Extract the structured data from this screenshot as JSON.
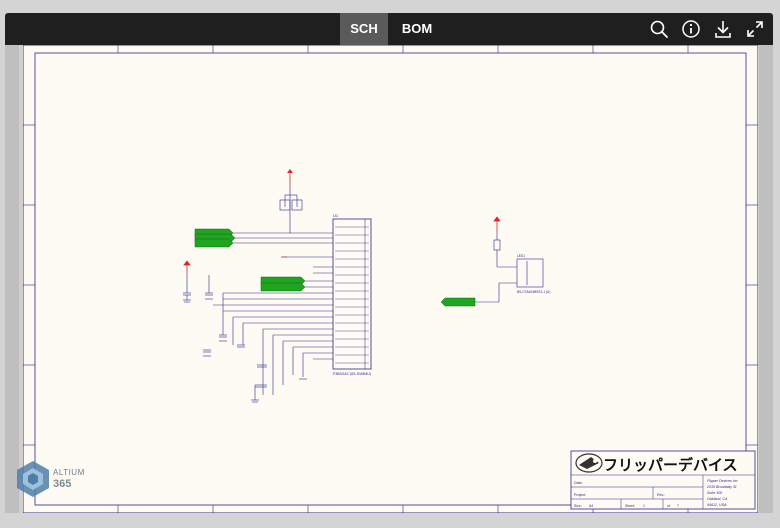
{
  "toolbar": {
    "tabs": [
      {
        "label": "SCH",
        "active": true
      },
      {
        "label": "BOM",
        "active": false
      }
    ],
    "icons": [
      "search-icon",
      "info-icon",
      "download-icon",
      "fullscreen-icon"
    ]
  },
  "schematic": {
    "ic_label": "U1",
    "ic_part": "P3B4GAC (6S-SVMMU)",
    "led_label": "LED1",
    "led_part": "BS-CTA4S4BSS1-1 (U)",
    "net_labels_green": [
      "SWD_MIO",
      "SWD_CLK",
      "SWD_RST",
      "UART_TX",
      "UART_RX",
      "LED_CTRL"
    ],
    "title_block": {
      "logo_text": "フリッパーデバイス",
      "company_lines": [
        "Flipper Devices Inc",
        "2035 Broadway St",
        "Suite 300",
        "Oakland, CA",
        "94612, USA"
      ],
      "date_label": "Date:",
      "project_label": "Project:",
      "rev_label": "Rev.:",
      "size_label": "Size:",
      "size_value": "A4",
      "sheet_label": "Sheet:",
      "sheet_value": "1",
      "of_label": "of",
      "of_value": "7"
    }
  },
  "branding": {
    "line1": "ALTIUM",
    "line2": "365"
  },
  "colors": {
    "toolbar_bg": "#1f1f1f",
    "active_tab": "#5a5a5a",
    "sheet_bg": "#fdfbf3",
    "wire": "#2a2a8a",
    "net_label_fill": "#1fa51f",
    "power_red": "#d42a2a"
  }
}
